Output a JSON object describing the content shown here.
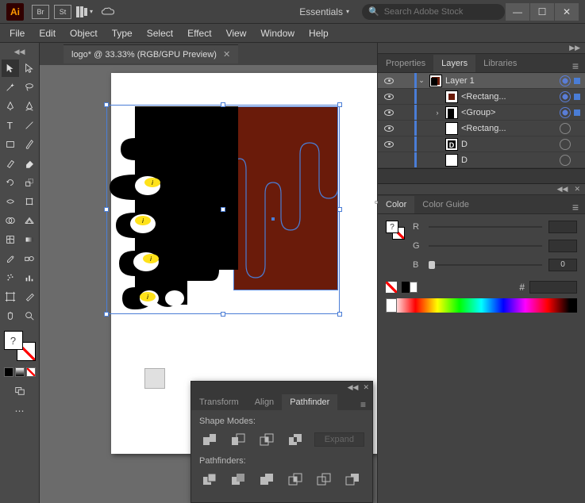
{
  "titlebar": {
    "logo": "Ai",
    "br_label": "Br",
    "st_label": "St",
    "workspace": "Essentials",
    "search_placeholder": "Search Adobe Stock"
  },
  "menu": {
    "file": "File",
    "edit": "Edit",
    "object": "Object",
    "type": "Type",
    "select": "Select",
    "effect": "Effect",
    "view": "View",
    "window": "Window",
    "help": "Help"
  },
  "doc_tab": {
    "title": "logo* @ 33.33% (RGB/GPU Preview)"
  },
  "pathfinder": {
    "tabs": {
      "transform": "Transform",
      "align": "Align",
      "pathfinder": "Pathfinder"
    },
    "shape_modes": "Shape Modes:",
    "pathfinders": "Pathfinders:",
    "expand": "Expand"
  },
  "right_panels": {
    "properties": "Properties",
    "layers": "Layers",
    "libraries": "Libraries",
    "color": "Color",
    "color_guide": "Color Guide"
  },
  "layers": {
    "items": [
      {
        "name": "Layer 1"
      },
      {
        "name": "<Rectang..."
      },
      {
        "name": "<Group>"
      },
      {
        "name": "<Rectang..."
      },
      {
        "name": "D"
      },
      {
        "name": "D"
      }
    ]
  },
  "color": {
    "r": "R",
    "g": "G",
    "b": "B",
    "b_val": "0",
    "hex_prefix": "#"
  }
}
